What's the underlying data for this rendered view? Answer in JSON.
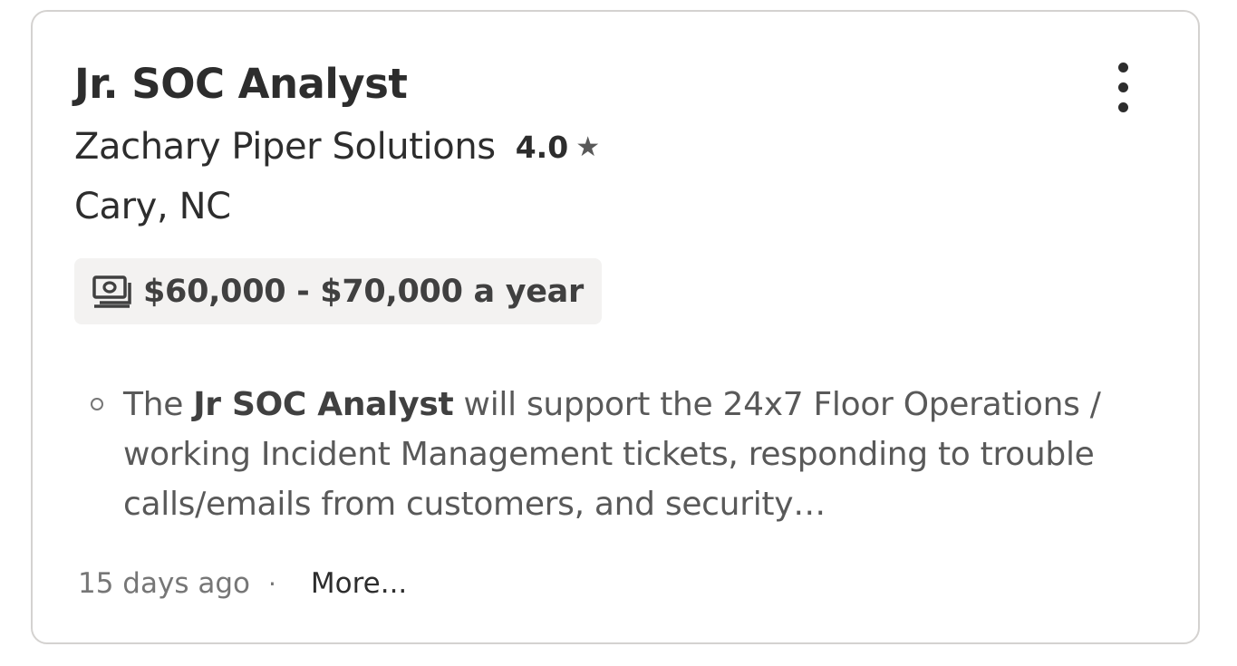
{
  "job": {
    "title": "Jr. SOC Analyst",
    "company": "Zachary Piper Solutions",
    "rating": "4.0",
    "location": "Cary, NC",
    "salary": "$60,000 - $70,000 a year",
    "snippet": {
      "prefix": "The ",
      "highlight": "Jr SOC Analyst",
      "suffix": " will support the 24x7 Floor Operations / working Incident Management tickets, responding to trouble calls/emails from customers, and security…"
    },
    "posted": "15 days ago",
    "separator": "·",
    "more_link": "More..."
  },
  "icons": {
    "menu": "more-vertical-icon",
    "rating": "star-icon",
    "salary": "money-icon",
    "bullet": "circle-bullet-icon"
  },
  "colors": {
    "text_primary": "#2d2d2d",
    "text_secondary": "#595959",
    "text_muted": "#767676",
    "salary_bg": "#f3f2f1",
    "border": "#d4d2d0"
  }
}
